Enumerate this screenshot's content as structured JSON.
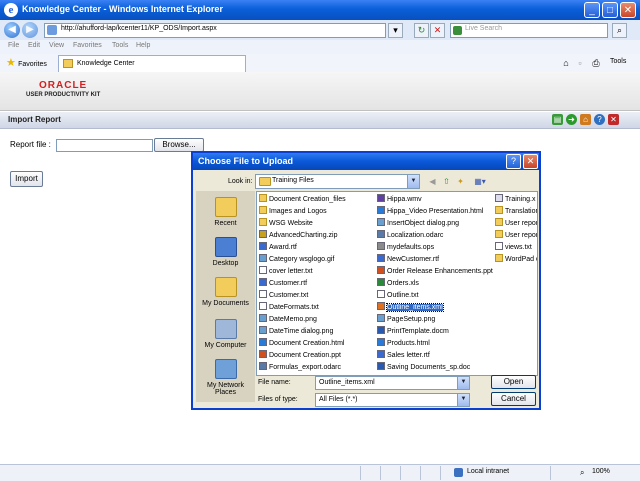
{
  "window": {
    "title": "Knowledge Center - Windows Internet Explorer"
  },
  "address_bar": {
    "url": "http://ahufford-lap/kcenter11/KP_ODS/Import.aspx",
    "search_placeholder": "Live Search"
  },
  "menu": [
    "File",
    "Edit",
    "View",
    "Favorites",
    "Tools",
    "Help"
  ],
  "favorites": {
    "label": "Favorites",
    "tab_title": "Knowledge Center",
    "tools_label": "Tools"
  },
  "page": {
    "logo_top": "ORACLE",
    "logo_bottom": "USER PRODUCTIVITY KIT",
    "section_title": "Import Report",
    "report_file_label": "Report file :",
    "browse_label": "Browse...",
    "import_label": "Import"
  },
  "dialog": {
    "title": "Choose File to Upload",
    "look_in_label": "Look in:",
    "look_in_value": "Training Files",
    "places": [
      "Recent",
      "Desktop",
      "My Documents",
      "My Computer",
      "My Network Places"
    ],
    "columns": [
      [
        "Document Creation_files",
        "Images and Logos",
        "WSG Website",
        "AdvancedCharting.zip",
        "Award.rtf",
        "Category wsglogo.gif",
        "cover letter.txt",
        "Customer.rtf",
        "Customer.txt",
        "DateFormats.txt",
        "DateMemo.png",
        "DateTime dialog.png",
        "Document Creation.html",
        "Document Creation.ppt",
        "Formulas_export.odarc"
      ],
      [
        "Hippa.wmv",
        "Hippa_Video Presentation.html",
        "InsertObject dialog.png",
        "Localization.odarc",
        "mydefaults.ops",
        "NewCustomer.rtf",
        "Order Release Enhancements.ppt",
        "Orders.xls",
        "Outline.txt",
        "Outline_items.xml",
        "PageSetup.png",
        "PrintTemplate.docm",
        "Products.html",
        "Sales letter.rtf",
        "Saving Documents_sp.doc"
      ],
      [
        "Training.x",
        "Translation",
        "User repor",
        "User repor",
        "views.txt",
        "WordPad d"
      ]
    ],
    "selected_file": "Outline_items.xml",
    "file_name_label": "File name:",
    "file_name_value": "Outline_items.xml",
    "file_type_label": "Files of type:",
    "file_type_value": "All Files (*.*)",
    "open_label": "Open",
    "cancel_label": "Cancel"
  },
  "status": {
    "zone": "Local intranet",
    "zoom": "100%"
  }
}
